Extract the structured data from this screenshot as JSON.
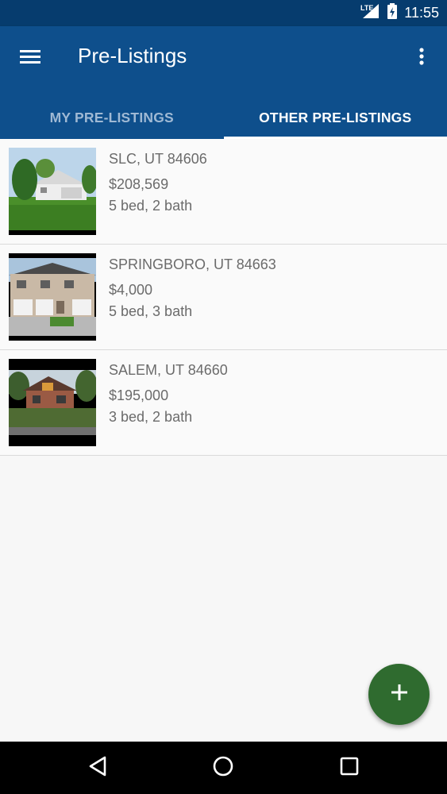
{
  "status_bar": {
    "time": "11:55",
    "network_label": "LTE"
  },
  "app_bar": {
    "title": "Pre-Listings",
    "menu_icon": "hamburger-menu-icon",
    "more_icon": "more-vert-icon"
  },
  "tabs": [
    {
      "label": "MY PRE-LISTINGS",
      "active": false
    },
    {
      "label": "OTHER PRE-LISTINGS",
      "active": true
    }
  ],
  "listings": [
    {
      "address": "SLC, UT 84606",
      "price": "$208,569",
      "details": "5 bed, 2 bath"
    },
    {
      "address": "SPRINGBORO, UT 84663",
      "price": "$4,000",
      "details": "5 bed, 3 bath"
    },
    {
      "address": "SALEM, UT 84660",
      "price": "$195,000",
      "details": "3 bed, 2 bath"
    }
  ],
  "fab": {
    "icon": "add-icon"
  },
  "colors": {
    "status_bar": "#063c6e",
    "app_bar": "#0e4f8c",
    "fab": "#2f6b2f",
    "text_secondary": "#6b6b6b"
  }
}
